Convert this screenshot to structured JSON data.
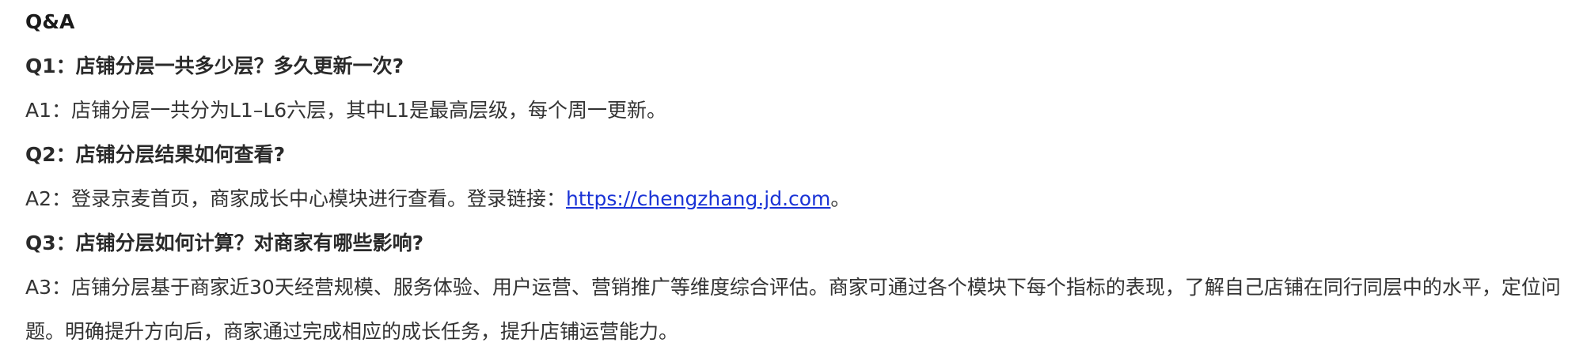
{
  "title": "Q&A",
  "items": [
    {
      "question": "Q1：店铺分层一共多少层？多久更新一次?",
      "answer": "A1：店铺分层一共分为L1–L6六层，其中L1是最高层级，每个周一更新。"
    },
    {
      "question": "Q2：店铺分层结果如何查看?",
      "answer_prefix": "A2：登录京麦首页，商家成长中心模块进行查看。登录链接：",
      "link_text": "https://chengzhang.jd.com",
      "answer_suffix": "。"
    },
    {
      "question": "Q3：店铺分层如何计算？对商家有哪些影响?",
      "answer": "A3：店铺分层基于商家近30天经营规模、服务体验、用户运营、营销推广等维度综合评估。商家可通过各个模块下每个指标的表现，了解自己店铺在同行同层中的水平，定位问题。明确提升方向后，商家通过完成相应的成长任务，提升店铺运营能力。"
    }
  ]
}
